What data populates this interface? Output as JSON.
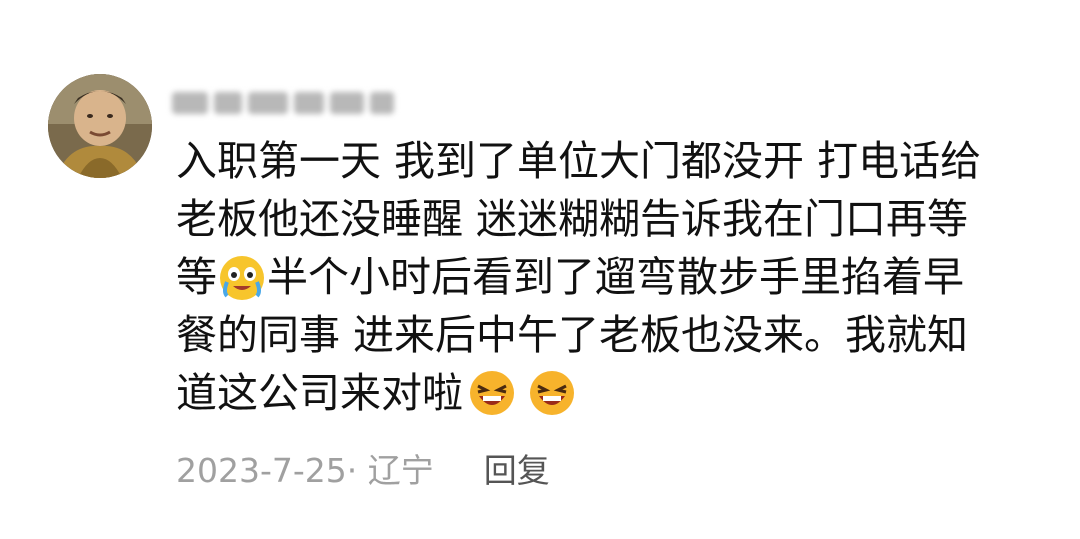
{
  "comment": {
    "lines": [
      {
        "text": "入职第一天 我到了单位大门都没开 打电话给"
      },
      {
        "text": "老板他还没睡醒 迷迷糊糊告诉我在门口再等"
      },
      {
        "pre": "等",
        "emoji": "crying-laughing-emoji",
        "post": " 半个小时后看到了遛弯散步手里掐着早"
      },
      {
        "text": "餐的同事 进来后中午了老板也没来。我就知"
      },
      {
        "pre": "道这公司来对啦",
        "emojis": [
          "laughing-emoji",
          "laughing-emoji"
        ]
      }
    ]
  },
  "meta": {
    "date_location": "2023-7-25· 辽宁",
    "reply_label": "回复"
  }
}
